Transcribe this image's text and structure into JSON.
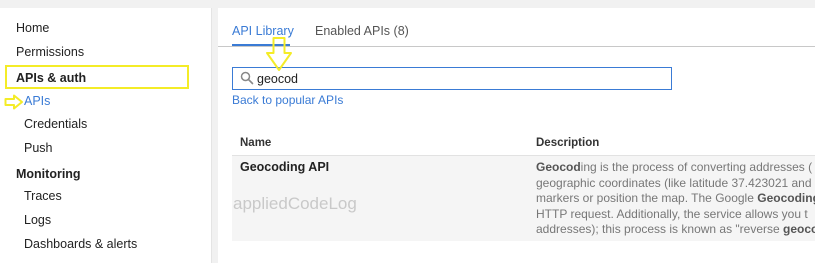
{
  "sidebar": {
    "home": "Home",
    "permissions": "Permissions",
    "apis_auth": "APIs & auth",
    "apis": "APIs",
    "credentials": "Credentials",
    "push": "Push",
    "monitoring": "Monitoring",
    "traces": "Traces",
    "logs": "Logs",
    "dashboards": "Dashboards & alerts"
  },
  "tabs": {
    "api_library": "API Library",
    "enabled_apis": "Enabled APIs (8)"
  },
  "search": {
    "value": "geocod"
  },
  "back_link": "Back to popular APIs",
  "table": {
    "col_name": "Name",
    "col_description": "Description",
    "rows": [
      {
        "name": "Geocoding API",
        "desc_lines": [
          {
            "bold": "Geocod",
            "rest": "ing is the process of converting addresses ("
          },
          {
            "bold": "",
            "rest": "geographic coordinates (like latitude 37.423021 and"
          },
          {
            "bold": "",
            "rest": "markers or position the map. The Google "
          },
          {
            "bold": "",
            "rest": "HTTP request. Additionally, the service allows you t"
          },
          {
            "bold": "",
            "rest": "addresses); this process is known as \"reverse "
          }
        ],
        "desc_line3_bold": "Geocoding",
        "desc_line5_bold": "geoco"
      }
    ]
  },
  "watermark": "appliedCodeLog",
  "colors": {
    "accent": "#3a7bd5",
    "highlight": "#f4ec27"
  }
}
